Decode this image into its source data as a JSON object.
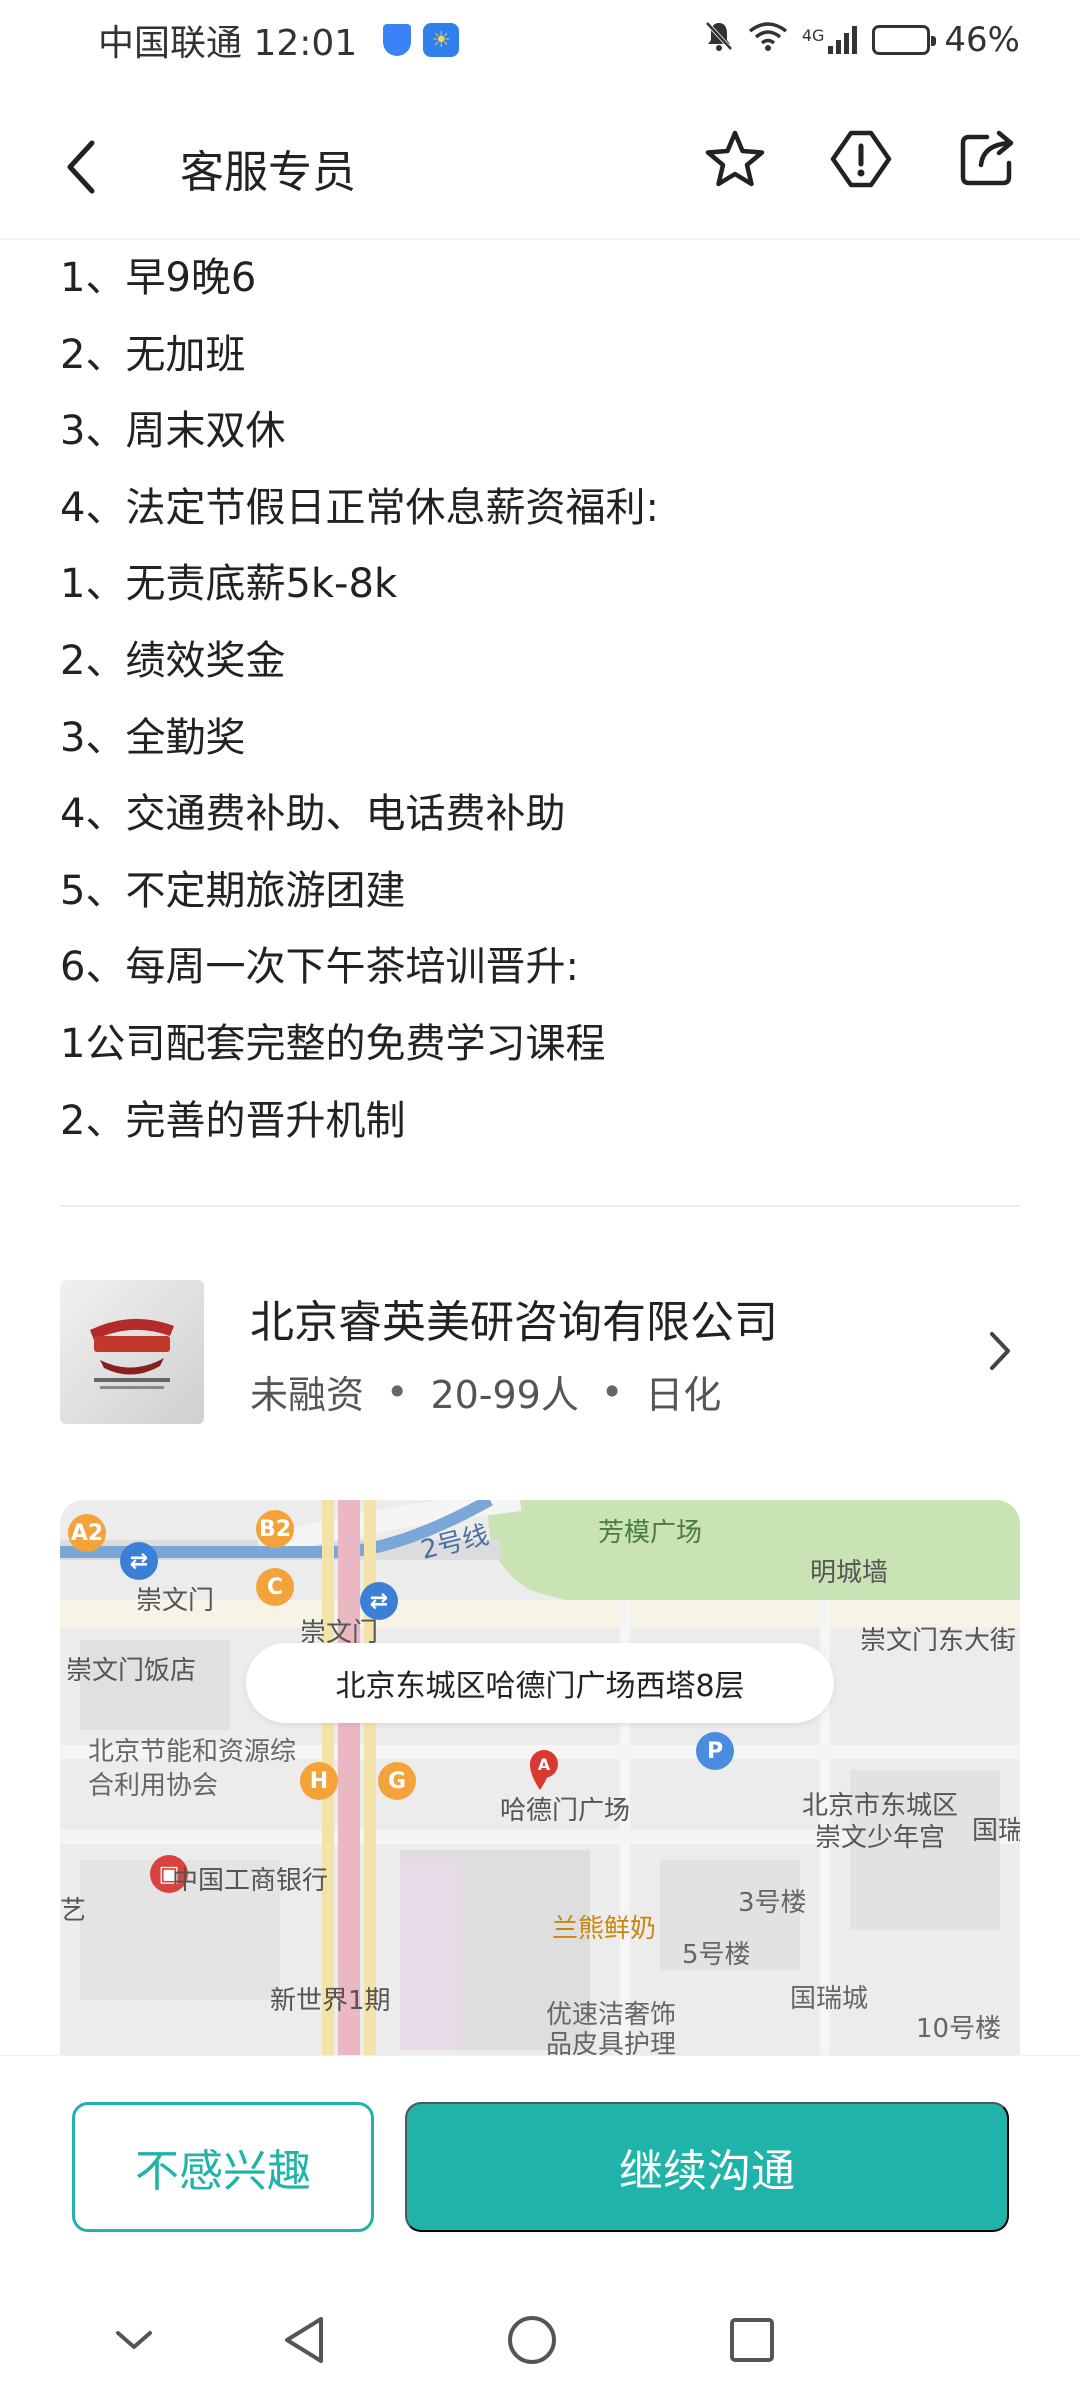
{
  "status_bar": {
    "carrier_time": "中国联通 12:01",
    "network": "4G",
    "battery": "46%",
    "battery_level": 0.46,
    "icons": [
      "shield-icon",
      "weather-icon",
      "mute-icon",
      "wifi-icon",
      "signal-icon",
      "battery-icon"
    ]
  },
  "header": {
    "title": "客服专员",
    "icons": [
      "back-icon",
      "star-icon",
      "report-icon",
      "share-icon"
    ]
  },
  "description": [
    "1、早9晚6",
    "2、无加班",
    "3、周末双休",
    "4、法定节假日正常休息薪资福利:",
    "1、无责底薪5k-8k",
    "2、绩效奖金",
    "3、全勤奖",
    "4、交通费补助、电话费补助",
    "5、不定期旅游团建",
    "6、每周一次下午茶培训晋升:",
    "1公司配套完整的免费学习课程",
    "2、完善的晋升机制"
  ],
  "company": {
    "name": "北京睿英美研咨询有限公司",
    "funding": "未融资",
    "size": "20-99人",
    "industry": "日化",
    "separator": "•"
  },
  "map": {
    "address": "北京东城区哈德门广场西塔8层",
    "labels": {
      "line2": "2号线",
      "fangmo": "芳模广场",
      "mingcheng": "明城墙",
      "chongwenmen": "崇文门",
      "chongwenmen2": "崇文门",
      "chongwenmen_east": "崇文门东大街",
      "hotel": "崇文门饭店",
      "energy": "北京节能和资源综合利用协会",
      "hademen": "哈德门广场",
      "youth": "北京市东城区崇文少年宫",
      "guorui_edge": "国瑞",
      "icbc": "中国工商银行",
      "yi": "艺",
      "lanxiong": "兰熊鲜奶",
      "bldg3": "3号楼",
      "bldg5": "5号楼",
      "guoruicheng": "国瑞城",
      "newworld": "新世界1期",
      "luxury": "优速洁奢饰品皮具护理",
      "bldg10": "10号楼"
    },
    "poi_letters": {
      "a2": "A2",
      "b2": "B2",
      "c": "C",
      "h": "H",
      "g": "G",
      "p": "P",
      "marker": "A"
    }
  },
  "actions": {
    "not_interested": "不感兴趣",
    "continue_chat": "继续沟通",
    "accent": "#1fb3aa"
  },
  "system_nav": {
    "icons": [
      "collapse-icon",
      "nav-back-icon",
      "home-icon",
      "recents-icon"
    ]
  }
}
